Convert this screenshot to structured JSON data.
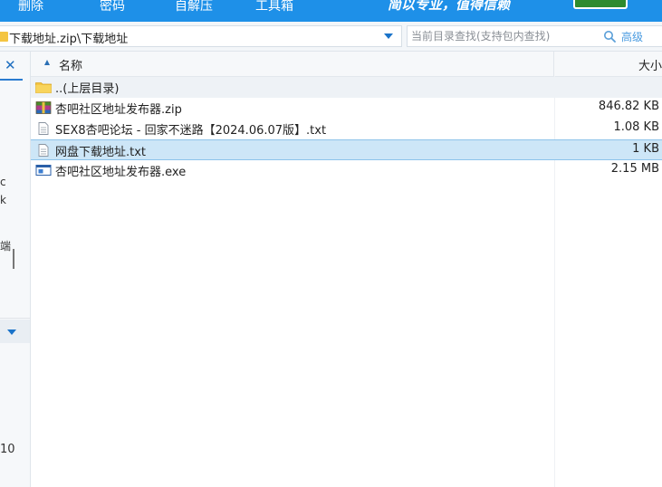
{
  "toolbar": {
    "items": [
      "删除",
      "密码",
      "自解压",
      "工具箱"
    ],
    "promo": "简以专业，值得信赖"
  },
  "address": {
    "path": "下载地址.zip\\下载地址"
  },
  "search": {
    "placeholder": "当前目录查找(支持包内查找)",
    "advanced": "高级"
  },
  "left_panel": {
    "fragments": [
      "c",
      "k",
      "端"
    ],
    "bottom_number": "10"
  },
  "columns": {
    "name": "名称",
    "size": "大小"
  },
  "files": [
    {
      "name": "..(上层目录)",
      "size": "",
      "icon": "folder-up-icon"
    },
    {
      "name": "杏吧社区地址发布器.zip",
      "size": "846.82 KB",
      "icon": "zip-archive-icon"
    },
    {
      "name": "SEX8杏吧论坛 - 回家不迷路【2024.06.07版】.txt",
      "size": "1.08 KB",
      "icon": "text-file-icon"
    },
    {
      "name": "网盘下载地址.txt",
      "size": "1 KB",
      "icon": "text-file-icon"
    },
    {
      "name": "杏吧社区地址发布器.exe",
      "size": "2.15 MB",
      "icon": "exe-file-icon"
    }
  ],
  "colors": {
    "toolbar_blue": "#1e90e8",
    "selection": "#cde6f7",
    "accent": "#1a73c9"
  }
}
